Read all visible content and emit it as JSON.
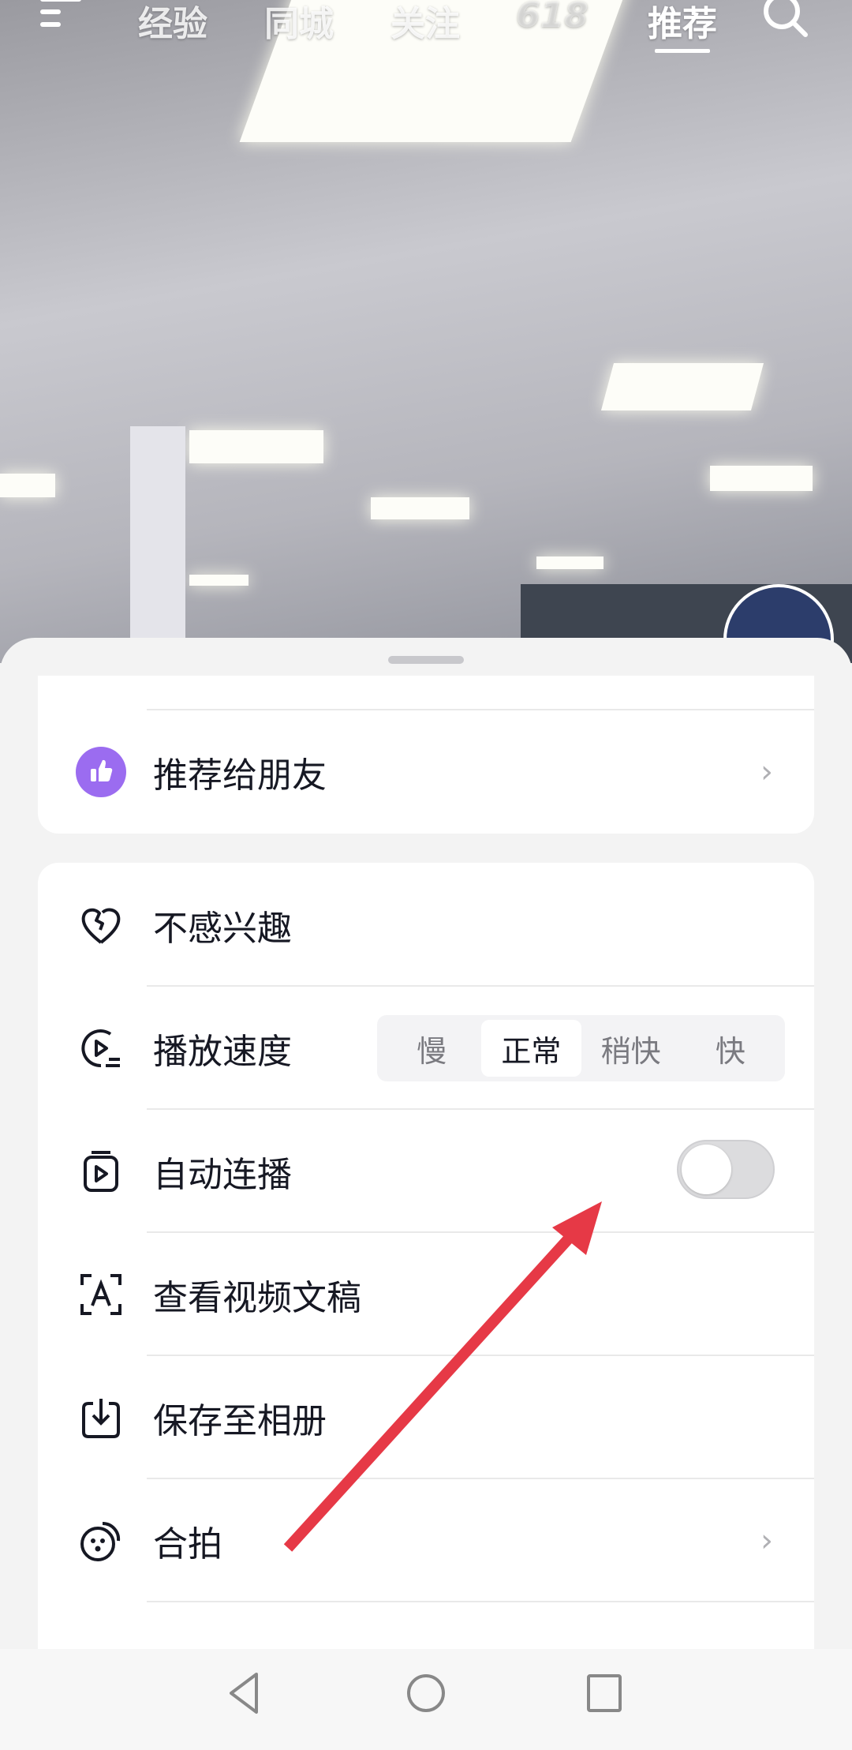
{
  "top_nav": {
    "tabs": [
      "经验",
      "同城",
      "关注",
      "618",
      "推荐"
    ],
    "active": "推荐"
  },
  "share_card": {
    "item": {
      "label": "推荐给朋友",
      "icon": "thumbs-up-icon",
      "icon_color": "#9b6cf0"
    }
  },
  "menu": {
    "items": [
      {
        "label": "不感兴趣",
        "icon": "broken-heart-icon"
      },
      {
        "label": "播放速度",
        "icon": "play-speed-icon"
      },
      {
        "label": "自动连播",
        "icon": "autoplay-icon"
      },
      {
        "label": "查看视频文稿",
        "icon": "transcript-icon"
      },
      {
        "label": "保存至相册",
        "icon": "download-icon"
      },
      {
        "label": "合拍",
        "icon": "duet-icon"
      }
    ],
    "speed_options": [
      "慢",
      "正常",
      "稍快",
      "快"
    ],
    "speed_selected": "正常",
    "autoplay_on": false
  },
  "annotation": {
    "arrow_color": "#e63946"
  }
}
